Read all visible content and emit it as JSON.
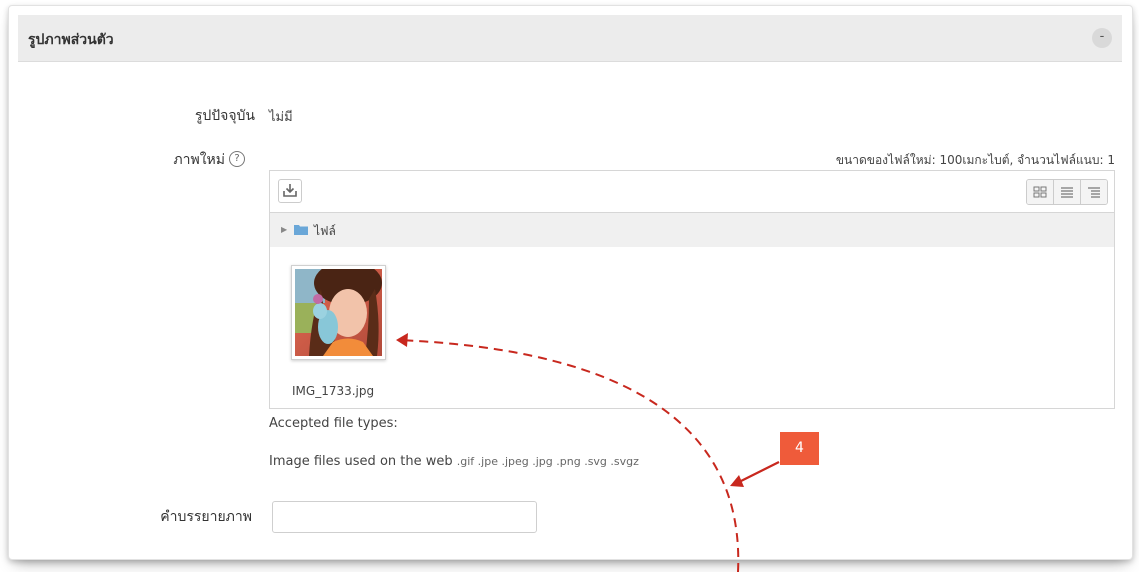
{
  "section": {
    "title": "รูปภาพส่วนตัว",
    "collapse_label": "-"
  },
  "current_picture": {
    "label": "รูปปัจจุบัน",
    "value": "ไม่มี"
  },
  "new_picture": {
    "label": "ภาพใหม่",
    "help_icon": "question-circle-icon",
    "help_glyph": "?"
  },
  "file_info": "ขนาดของไฟล์ใหม่: 100เมกะไบต์, จำนวนไฟล์แนบ: 1",
  "file_manager": {
    "upload_icon": "download-icon",
    "views": [
      "grid-view-icon",
      "list-view-icon",
      "tree-view-icon"
    ],
    "path_label": "ไฟล์",
    "file": {
      "name": "IMG_1733.jpg"
    }
  },
  "accepted": {
    "title": "Accepted file types:",
    "description": "Image files used on the web",
    "extensions": ".gif .jpe .jpeg .jpg .png .svg .svgz"
  },
  "caption": {
    "label": "คำบรรยายภาพ",
    "value": ""
  },
  "annotation": {
    "badge": "4",
    "color": "#ef5b3a",
    "arrow_color": "#c8281e"
  }
}
